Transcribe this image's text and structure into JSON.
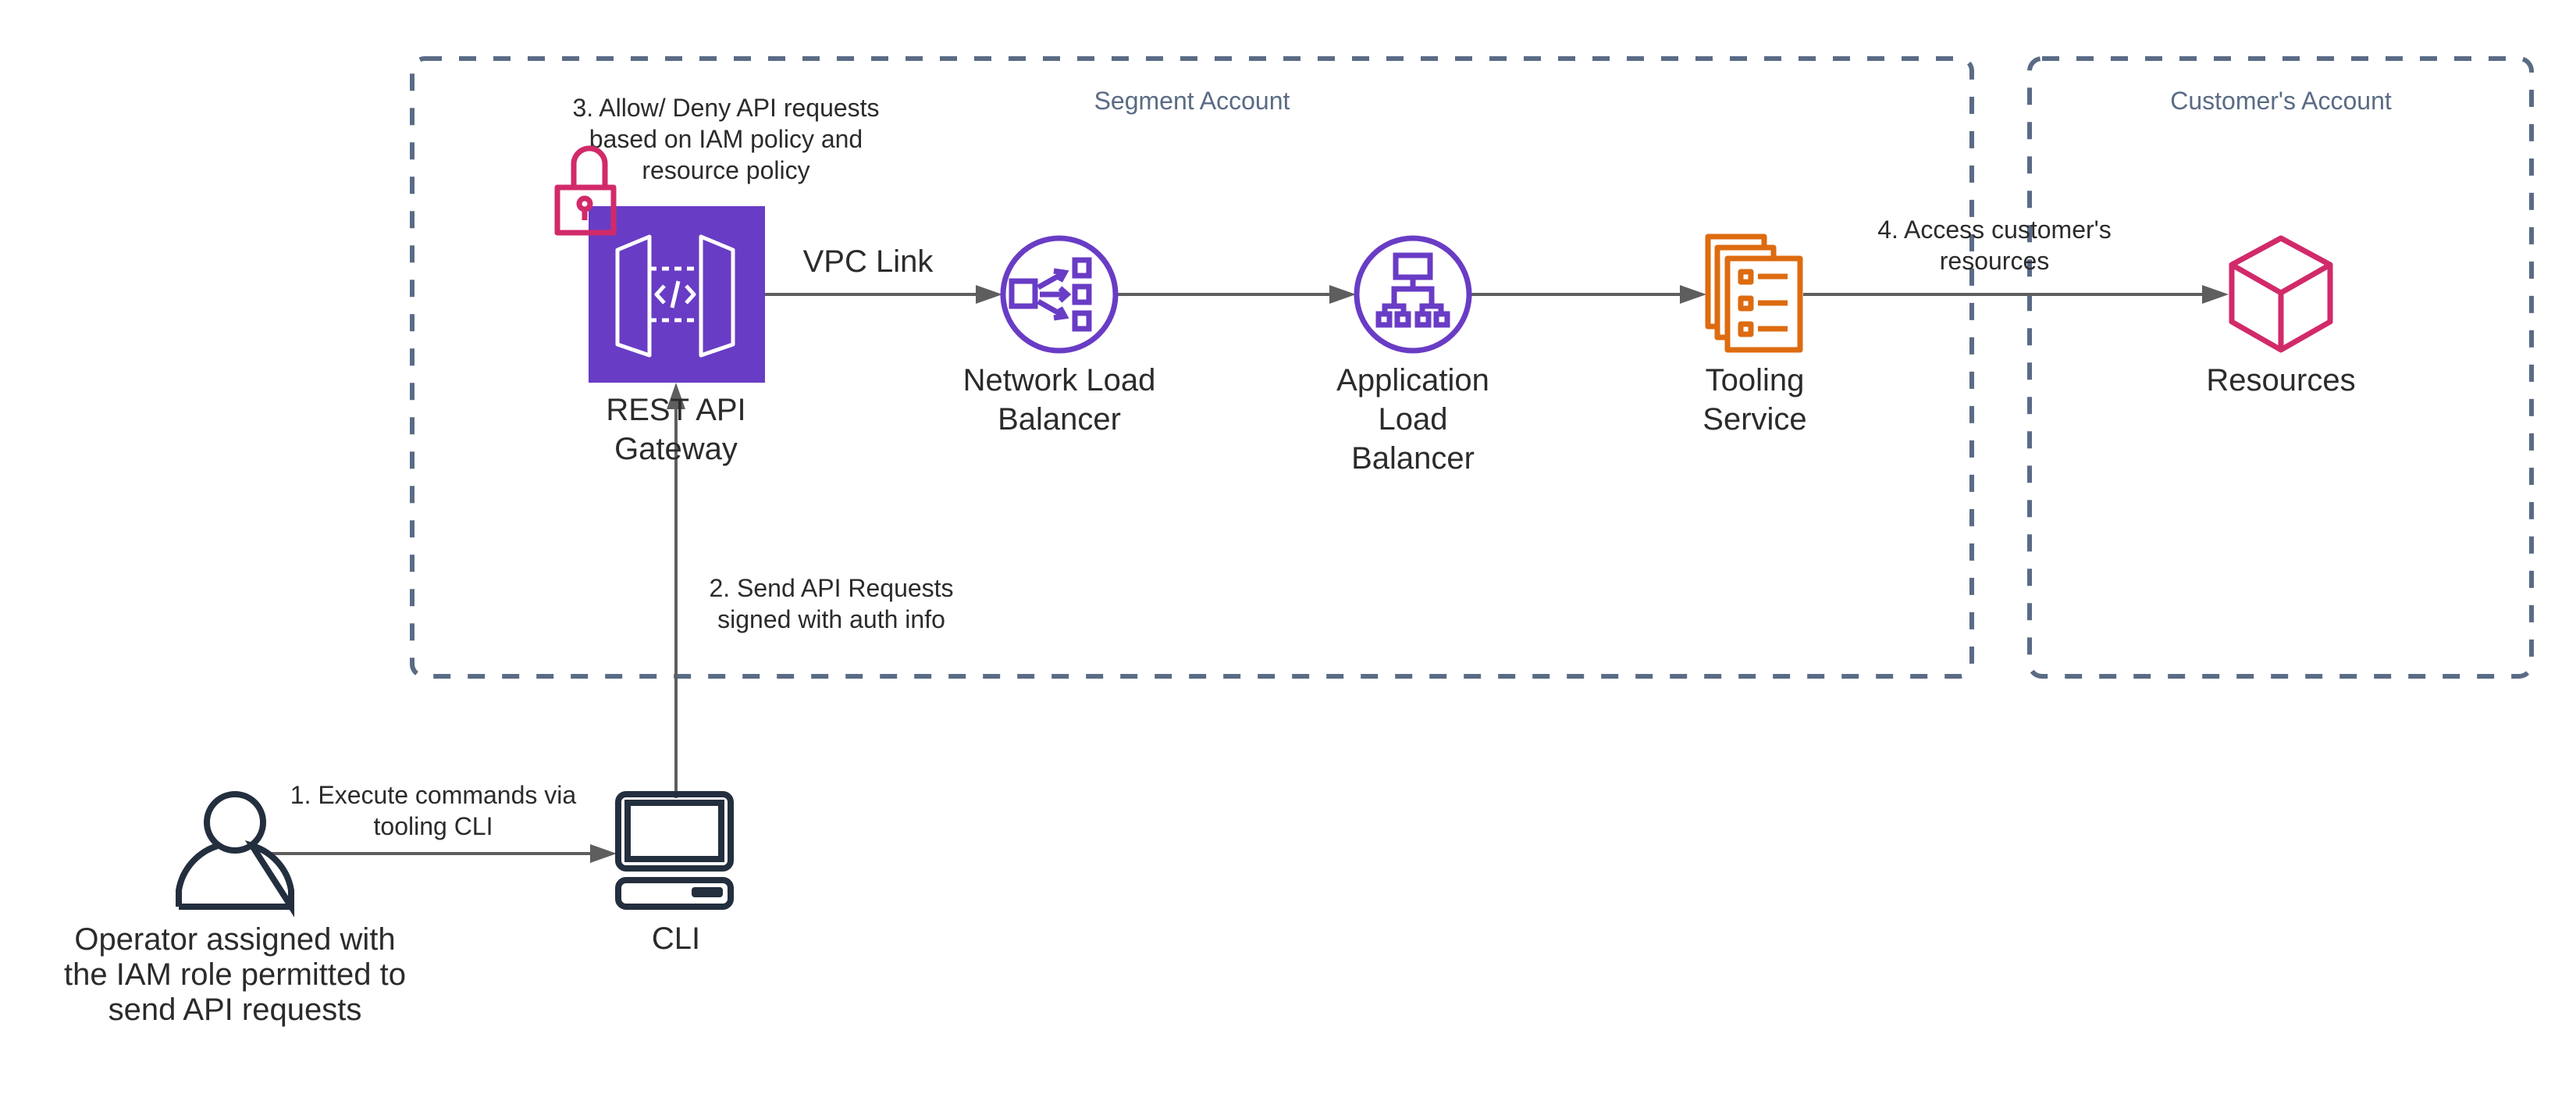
{
  "colors": {
    "group_border": "#5a6b85",
    "api_gateway": "#693CC5",
    "load_balancer": "#693CC5",
    "tooling_service": "#DD6B10",
    "resources": "#D12A6A",
    "lock": "#D12A6A",
    "actor": "#232f3e",
    "edge": "#5e5e5e",
    "text": "#2b2b2b"
  },
  "groups": {
    "segment": {
      "label": "Segment Account"
    },
    "customer": {
      "label": "Customer's Account"
    }
  },
  "nodes": {
    "api_gateway": {
      "label_lines": [
        "REST API",
        "Gateway"
      ],
      "icon": "api-gateway-icon"
    },
    "nlb": {
      "label_lines": [
        "Network Load",
        "Balancer"
      ],
      "icon": "network-load-balancer-icon"
    },
    "alb": {
      "label_lines": [
        "Application",
        "Load",
        "Balancer"
      ],
      "icon": "application-load-balancer-icon"
    },
    "tooling": {
      "label_lines": [
        "Tooling",
        "Service"
      ],
      "icon": "tooling-service-icon"
    },
    "resources": {
      "label_lines": [
        "Resources"
      ],
      "icon": "resources-cube-icon"
    },
    "operator": {
      "label_lines": [
        "Operator assigned with",
        "the IAM role permitted to",
        "send API requests"
      ],
      "icon": "user-icon"
    },
    "cli": {
      "label_lines": [
        "CLI"
      ],
      "icon": "computer-icon"
    },
    "lock": {
      "icon": "lock-icon"
    }
  },
  "edges": {
    "vpc_link": {
      "label": "VPC Link"
    },
    "step1": {
      "label_lines": [
        "1. Execute commands via",
        "tooling CLI"
      ]
    },
    "step2": {
      "label_lines": [
        "2. Send API Requests",
        "signed with auth info"
      ]
    },
    "step3": {
      "label_lines": [
        "3. Allow/ Deny API requests",
        "based on IAM policy and",
        "resource policy"
      ]
    },
    "step4": {
      "label_lines": [
        "4. Access customer's",
        "resources"
      ]
    }
  }
}
